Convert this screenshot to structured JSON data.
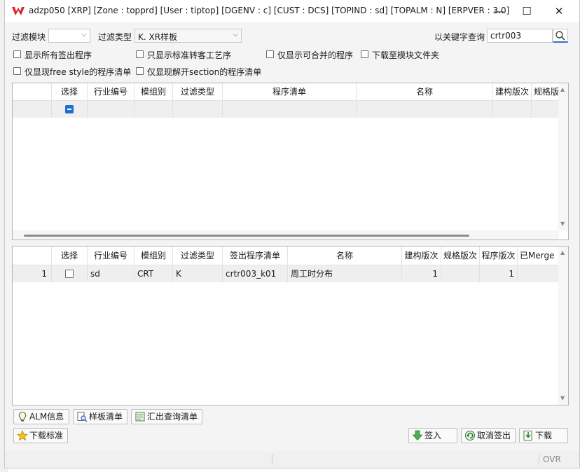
{
  "window": {
    "title": "adzp050 [XRP]  [Zone : topprd]  [User : tiptop]  [DGENV : c]  [CUST : DCS]  [TOPIND : sd]  [TOPALM : N]  [ERPVER : 3.0]",
    "minimize": "—",
    "maximize": "☐",
    "close": "✕"
  },
  "filters": {
    "module_label": "过滤模块",
    "module_value": "",
    "type_label": "过滤类型",
    "type_value": "K. XR样板",
    "keyword_label": "以关键字查询",
    "keyword_value": "crtr003"
  },
  "options": [
    "显示所有签出程序",
    "只显示标准转客工艺序",
    "仅显示可合并的程序",
    "下载至模块文件夹",
    "仅显现free style的程序清单",
    "仅显现解开section的程序清单"
  ],
  "top_grid": {
    "columns": [
      "选择",
      "行业编号",
      "模组别",
      "过滤类型",
      "程序清单",
      "名称",
      "建构版次",
      "规格版"
    ]
  },
  "bottom_grid": {
    "columns": [
      "选择",
      "行业编号",
      "模组别",
      "过滤类型",
      "签出程序清单",
      "名称",
      "建构版次",
      "规格版次",
      "程序版次",
      "已Merge"
    ],
    "rows": [
      {
        "num": "1",
        "industry": "sd",
        "module": "CRT",
        "type": "K",
        "program": "crtr003_k01",
        "name": "周工时分布",
        "build_ver": "1",
        "spec_ver": "",
        "prog_ver": "1",
        "merged": ""
      }
    ]
  },
  "buttons": {
    "alm_info": "ALM信息",
    "template_list": "样板清单",
    "export_list": "汇出查询清单",
    "download_std": "下载标准",
    "checkin": "签入",
    "cancel_checkout": "取消签出",
    "download": "下载"
  },
  "status": {
    "ovr": "OVR"
  }
}
